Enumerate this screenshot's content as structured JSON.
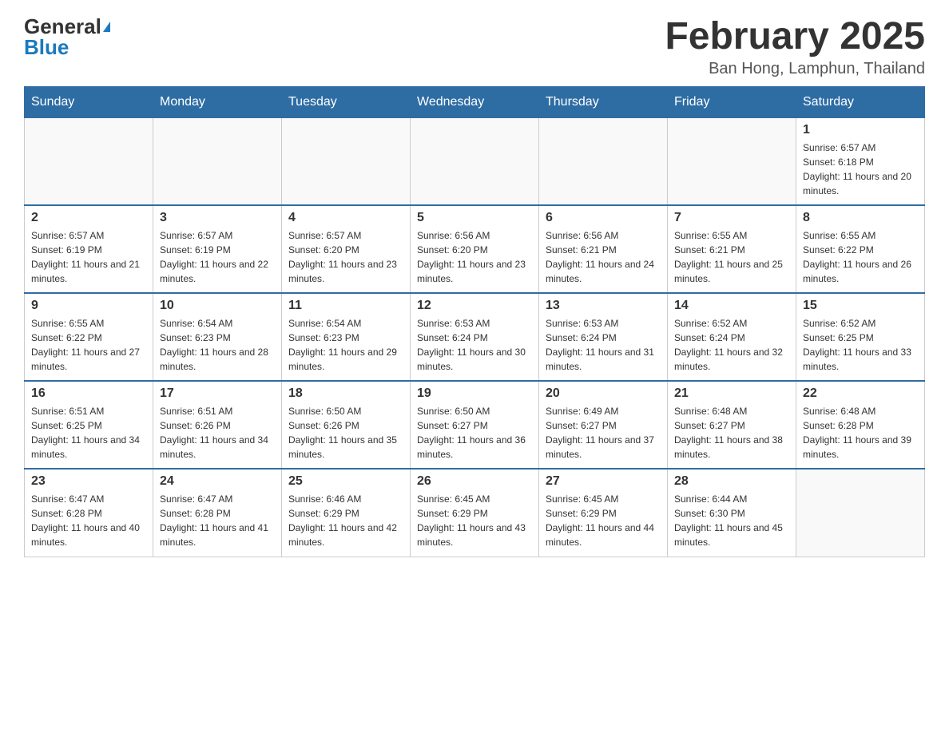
{
  "header": {
    "logo_general": "General",
    "logo_blue": "Blue",
    "month_title": "February 2025",
    "location": "Ban Hong, Lamphun, Thailand"
  },
  "weekdays": [
    "Sunday",
    "Monday",
    "Tuesday",
    "Wednesday",
    "Thursday",
    "Friday",
    "Saturday"
  ],
  "weeks": [
    [
      {
        "day": "",
        "info": []
      },
      {
        "day": "",
        "info": []
      },
      {
        "day": "",
        "info": []
      },
      {
        "day": "",
        "info": []
      },
      {
        "day": "",
        "info": []
      },
      {
        "day": "",
        "info": []
      },
      {
        "day": "1",
        "info": [
          "Sunrise: 6:57 AM",
          "Sunset: 6:18 PM",
          "Daylight: 11 hours and 20 minutes."
        ]
      }
    ],
    [
      {
        "day": "2",
        "info": [
          "Sunrise: 6:57 AM",
          "Sunset: 6:19 PM",
          "Daylight: 11 hours and 21 minutes."
        ]
      },
      {
        "day": "3",
        "info": [
          "Sunrise: 6:57 AM",
          "Sunset: 6:19 PM",
          "Daylight: 11 hours and 22 minutes."
        ]
      },
      {
        "day": "4",
        "info": [
          "Sunrise: 6:57 AM",
          "Sunset: 6:20 PM",
          "Daylight: 11 hours and 23 minutes."
        ]
      },
      {
        "day": "5",
        "info": [
          "Sunrise: 6:56 AM",
          "Sunset: 6:20 PM",
          "Daylight: 11 hours and 23 minutes."
        ]
      },
      {
        "day": "6",
        "info": [
          "Sunrise: 6:56 AM",
          "Sunset: 6:21 PM",
          "Daylight: 11 hours and 24 minutes."
        ]
      },
      {
        "day": "7",
        "info": [
          "Sunrise: 6:55 AM",
          "Sunset: 6:21 PM",
          "Daylight: 11 hours and 25 minutes."
        ]
      },
      {
        "day": "8",
        "info": [
          "Sunrise: 6:55 AM",
          "Sunset: 6:22 PM",
          "Daylight: 11 hours and 26 minutes."
        ]
      }
    ],
    [
      {
        "day": "9",
        "info": [
          "Sunrise: 6:55 AM",
          "Sunset: 6:22 PM",
          "Daylight: 11 hours and 27 minutes."
        ]
      },
      {
        "day": "10",
        "info": [
          "Sunrise: 6:54 AM",
          "Sunset: 6:23 PM",
          "Daylight: 11 hours and 28 minutes."
        ]
      },
      {
        "day": "11",
        "info": [
          "Sunrise: 6:54 AM",
          "Sunset: 6:23 PM",
          "Daylight: 11 hours and 29 minutes."
        ]
      },
      {
        "day": "12",
        "info": [
          "Sunrise: 6:53 AM",
          "Sunset: 6:24 PM",
          "Daylight: 11 hours and 30 minutes."
        ]
      },
      {
        "day": "13",
        "info": [
          "Sunrise: 6:53 AM",
          "Sunset: 6:24 PM",
          "Daylight: 11 hours and 31 minutes."
        ]
      },
      {
        "day": "14",
        "info": [
          "Sunrise: 6:52 AM",
          "Sunset: 6:24 PM",
          "Daylight: 11 hours and 32 minutes."
        ]
      },
      {
        "day": "15",
        "info": [
          "Sunrise: 6:52 AM",
          "Sunset: 6:25 PM",
          "Daylight: 11 hours and 33 minutes."
        ]
      }
    ],
    [
      {
        "day": "16",
        "info": [
          "Sunrise: 6:51 AM",
          "Sunset: 6:25 PM",
          "Daylight: 11 hours and 34 minutes."
        ]
      },
      {
        "day": "17",
        "info": [
          "Sunrise: 6:51 AM",
          "Sunset: 6:26 PM",
          "Daylight: 11 hours and 34 minutes."
        ]
      },
      {
        "day": "18",
        "info": [
          "Sunrise: 6:50 AM",
          "Sunset: 6:26 PM",
          "Daylight: 11 hours and 35 minutes."
        ]
      },
      {
        "day": "19",
        "info": [
          "Sunrise: 6:50 AM",
          "Sunset: 6:27 PM",
          "Daylight: 11 hours and 36 minutes."
        ]
      },
      {
        "day": "20",
        "info": [
          "Sunrise: 6:49 AM",
          "Sunset: 6:27 PM",
          "Daylight: 11 hours and 37 minutes."
        ]
      },
      {
        "day": "21",
        "info": [
          "Sunrise: 6:48 AM",
          "Sunset: 6:27 PM",
          "Daylight: 11 hours and 38 minutes."
        ]
      },
      {
        "day": "22",
        "info": [
          "Sunrise: 6:48 AM",
          "Sunset: 6:28 PM",
          "Daylight: 11 hours and 39 minutes."
        ]
      }
    ],
    [
      {
        "day": "23",
        "info": [
          "Sunrise: 6:47 AM",
          "Sunset: 6:28 PM",
          "Daylight: 11 hours and 40 minutes."
        ]
      },
      {
        "day": "24",
        "info": [
          "Sunrise: 6:47 AM",
          "Sunset: 6:28 PM",
          "Daylight: 11 hours and 41 minutes."
        ]
      },
      {
        "day": "25",
        "info": [
          "Sunrise: 6:46 AM",
          "Sunset: 6:29 PM",
          "Daylight: 11 hours and 42 minutes."
        ]
      },
      {
        "day": "26",
        "info": [
          "Sunrise: 6:45 AM",
          "Sunset: 6:29 PM",
          "Daylight: 11 hours and 43 minutes."
        ]
      },
      {
        "day": "27",
        "info": [
          "Sunrise: 6:45 AM",
          "Sunset: 6:29 PM",
          "Daylight: 11 hours and 44 minutes."
        ]
      },
      {
        "day": "28",
        "info": [
          "Sunrise: 6:44 AM",
          "Sunset: 6:30 PM",
          "Daylight: 11 hours and 45 minutes."
        ]
      },
      {
        "day": "",
        "info": []
      }
    ]
  ]
}
